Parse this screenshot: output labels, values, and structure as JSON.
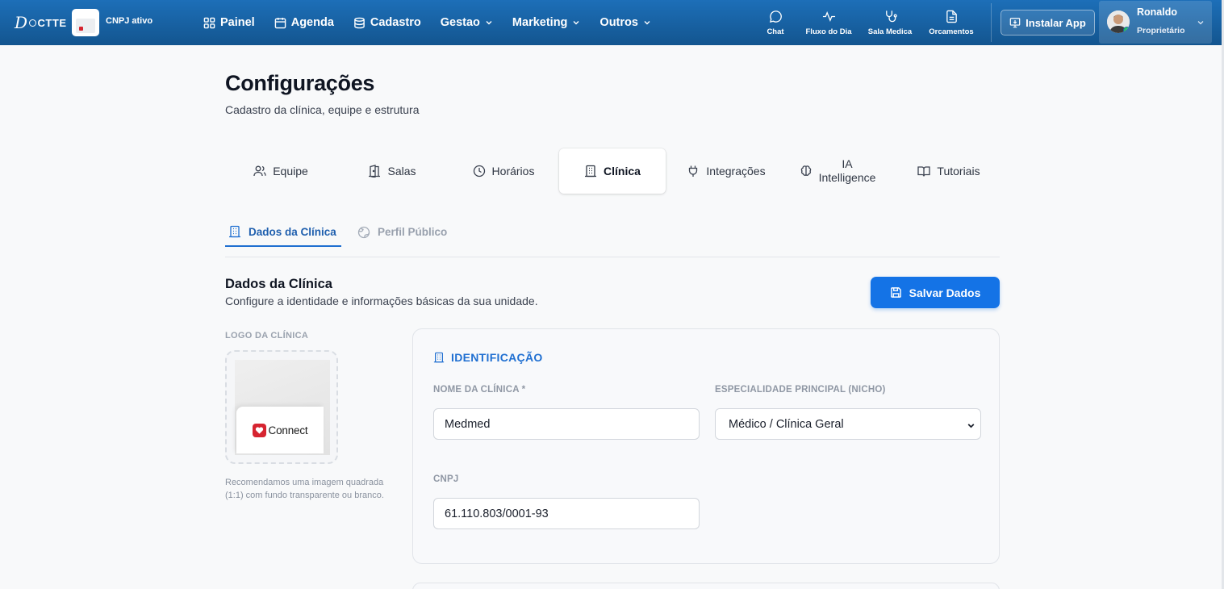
{
  "navbar": {
    "logo_text": "CTTE",
    "cnpj_status": "CNPJ ativo",
    "menu": [
      {
        "label": "Painel",
        "icon": "grid-icon"
      },
      {
        "label": "Agenda",
        "icon": "calendar-icon"
      },
      {
        "label": "Cadastro",
        "icon": "database-icon"
      },
      {
        "label": "Gestao",
        "icon": "chevron-down-icon"
      },
      {
        "label": "Marketing",
        "icon": "chevron-down-icon"
      },
      {
        "label": "Outros",
        "icon": "chevron-down-icon"
      }
    ],
    "quick_links": [
      {
        "label": "Chat",
        "icon": "chat-bubble-icon"
      },
      {
        "label": "Fluxo do Dia",
        "icon": "activity-icon"
      },
      {
        "label": "Sala Medica",
        "icon": "stethoscope-icon"
      },
      {
        "label": "Orcamentos",
        "icon": "document-icon"
      }
    ],
    "install_label": "Instalar App",
    "user": {
      "name": "Ronaldo",
      "role": "Proprietário"
    }
  },
  "page": {
    "title": "Configurações",
    "subtitle": "Cadastro da clínica, equipe e estrutura"
  },
  "main_tabs": [
    {
      "label": "Equipe",
      "icon": "users-icon"
    },
    {
      "label": "Salas",
      "icon": "door-icon"
    },
    {
      "label": "Horários",
      "icon": "clock-icon"
    },
    {
      "label": "Clínica",
      "icon": "building-icon",
      "active": true
    },
    {
      "label": "Integrações",
      "icon": "plug-icon"
    },
    {
      "label": "IA",
      "label2": "Intelligence",
      "icon": "brain-icon"
    },
    {
      "label": "Tutoriais",
      "icon": "book-icon"
    }
  ],
  "sub_tabs": [
    {
      "label": "Dados da Clínica",
      "icon": "building-icon",
      "active": true
    },
    {
      "label": "Perfil Público",
      "icon": "globe-icon"
    }
  ],
  "section": {
    "title": "Dados da Clínica",
    "description": "Configure a identidade e informações básicas da sua unidade.",
    "save_label": "Salvar Dados"
  },
  "logo": {
    "label": "LOGO DA CLÍNICA",
    "brand_text": "Connect",
    "hint": "Recomendamos uma imagem quadrada (1:1) com fundo transparente ou branco."
  },
  "identification": {
    "title": "IDENTIFICAÇÃO",
    "clinic_name_label": "NOME DA CLÍNICA *",
    "clinic_name_value": "Medmed",
    "specialty_label": "ESPECIALIDADE PRINCIPAL (NICHO)",
    "specialty_value": "Médico / Clínica Geral",
    "cnpj_label": "CNPJ",
    "cnpj_value": "61.110.803/0001-93"
  },
  "colors": {
    "navbar": "#1a63a6",
    "accent": "#1473e6",
    "active_tab_text": "#1f5fae",
    "online": "#22c55e"
  }
}
